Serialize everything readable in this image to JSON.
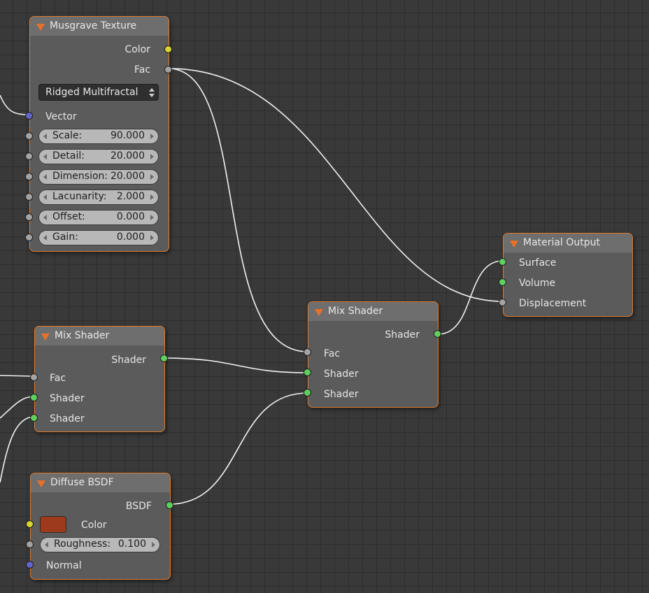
{
  "colors": {
    "background": "#393939",
    "node_border": "#e07b2c",
    "wire": "#f2f2f2",
    "socket_color": "#d6d62e",
    "socket_float": "#a3a3a3",
    "socket_vector": "#6363cc",
    "socket_shader": "#5fcf5f",
    "diffuse_color": "#9e3a1c"
  },
  "musgrave": {
    "title": "Musgrave Texture",
    "out_color": "Color",
    "out_fac": "Fac",
    "type": "Ridged Multifractal",
    "vector": "Vector",
    "fields": [
      {
        "name": "Scale:",
        "value": "90.000"
      },
      {
        "name": "Detail:",
        "value": "20.000"
      },
      {
        "name": "Dimension:",
        "value": "20.000"
      },
      {
        "name": "Lacunarity:",
        "value": "2.000"
      },
      {
        "name": "Offset:",
        "value": "0.000"
      },
      {
        "name": "Gain:",
        "value": "0.000"
      }
    ]
  },
  "mix_left": {
    "title": "Mix Shader",
    "out_shader": "Shader",
    "in_fac": "Fac",
    "in_shader1": "Shader",
    "in_shader2": "Shader"
  },
  "diffuse": {
    "title": "Diffuse BSDF",
    "out_bsdf": "BSDF",
    "color_label": "Color",
    "roughness_name": "Roughness:",
    "roughness_value": "0.100",
    "normal": "Normal"
  },
  "mix_center": {
    "title": "Mix Shader",
    "out_shader": "Shader",
    "in_fac": "Fac",
    "in_shader1": "Shader",
    "in_shader2": "Shader"
  },
  "material_output": {
    "title": "Material Output",
    "surface": "Surface",
    "volume": "Volume",
    "displacement": "Displacement"
  }
}
